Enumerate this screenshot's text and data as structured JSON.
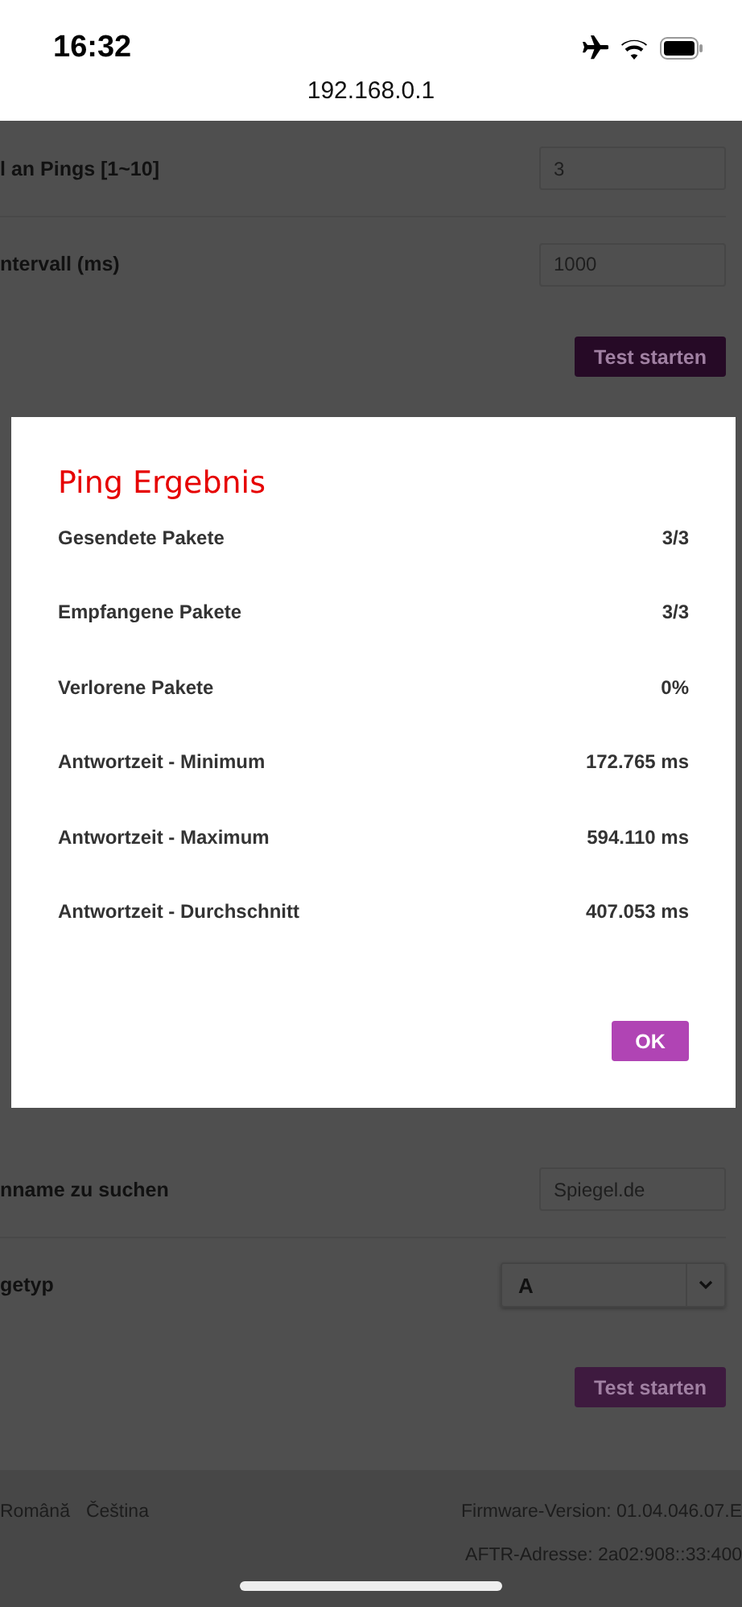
{
  "status_bar": {
    "time": "16:32"
  },
  "address_bar": {
    "url": "192.168.0.1"
  },
  "ping_form": {
    "rows": [
      {
        "kind": "input",
        "label": "l an Pings [1~10]",
        "value": "3"
      },
      {
        "kind": "input",
        "label": "ntervall (ms)",
        "value": "1000"
      }
    ],
    "button": "Test starten"
  },
  "dns_form": {
    "rows": [
      {
        "kind": "input",
        "label": "nname zu suchen",
        "value": "Spiegel.de"
      },
      {
        "kind": "select",
        "label": "getyp",
        "value": "A"
      }
    ],
    "button": "Test starten"
  },
  "footer": {
    "languages": [
      "Română",
      "Čeština"
    ],
    "firmware": "Firmware-Version: 01.04.046.07.E",
    "aftr": "AFTR-Adresse: 2a02:908::33:400"
  },
  "dialog": {
    "title": "Ping Ergebnis",
    "rows": [
      {
        "label": "Gesendete Pakete",
        "value": "3/3"
      },
      {
        "label": "Empfangene Pakete",
        "value": "3/3"
      },
      {
        "label": "Verlorene Pakete",
        "value": "0%"
      },
      {
        "label": "Antwortzeit - Minimum",
        "value": "172.765 ms"
      },
      {
        "label": "Antwortzeit - Maximum",
        "value": "594.110 ms"
      },
      {
        "label": "Antwortzeit - Durchschnitt",
        "value": "407.053 ms"
      }
    ],
    "button": "OK"
  }
}
